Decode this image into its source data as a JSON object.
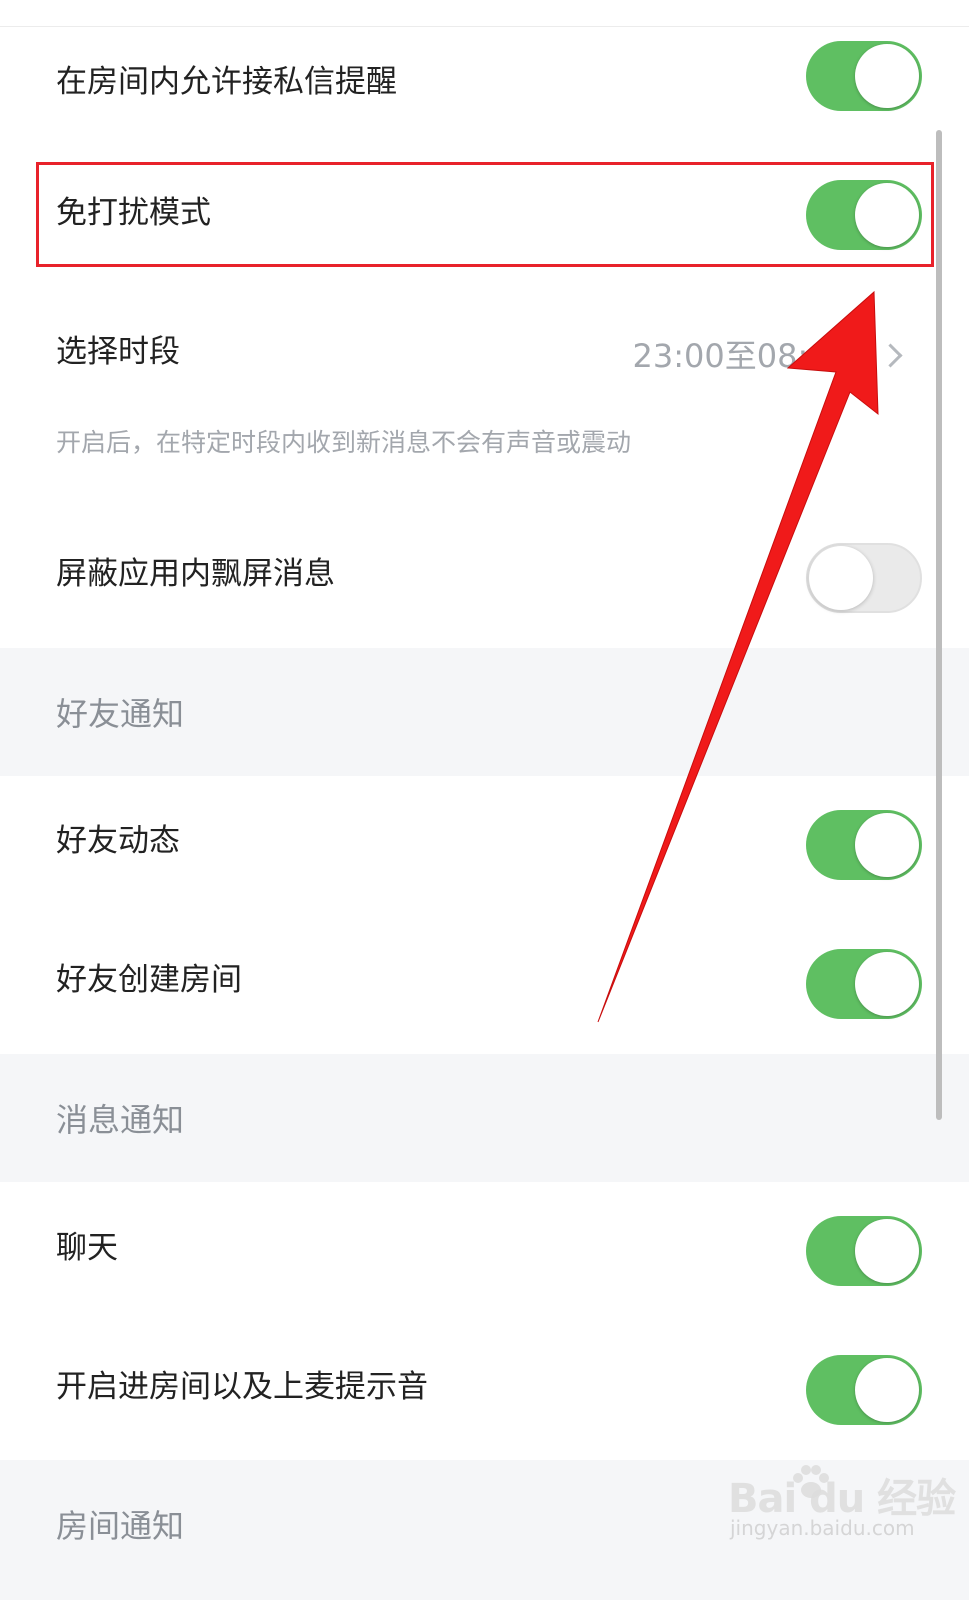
{
  "settings": {
    "rows": [
      {
        "label": "在房间内允许接私信提醒",
        "toggle_on": true
      },
      {
        "label": "免打扰模式",
        "toggle_on": true
      },
      {
        "label": "选择时段",
        "value": "23:00至08:00",
        "hint": "开启后，在特定时段内收到新消息不会有声音或震动"
      },
      {
        "label": "屏蔽应用内飘屏消息",
        "toggle_on": false
      }
    ],
    "friend_section": {
      "title": "好友通知",
      "rows": [
        {
          "label": "好友动态",
          "toggle_on": true
        },
        {
          "label": "好友创建房间",
          "toggle_on": true
        }
      ]
    },
    "message_section": {
      "title": "消息通知",
      "rows": [
        {
          "label": "聊天",
          "toggle_on": true
        },
        {
          "label": "开启进房间以及上麦提示音",
          "toggle_on": true
        }
      ]
    },
    "room_section": {
      "title": "房间通知"
    }
  },
  "annotation": {
    "highlight_color": "#e8222a",
    "arrow_color": "#f01a1a"
  },
  "watermark": {
    "logo": "Bai du 经验",
    "sub": "jingyan.baidu.com"
  },
  "colors": {
    "toggle_on": "#5fbf62",
    "toggle_off": "#eaeaea",
    "section_bg": "#f5f6f8"
  }
}
